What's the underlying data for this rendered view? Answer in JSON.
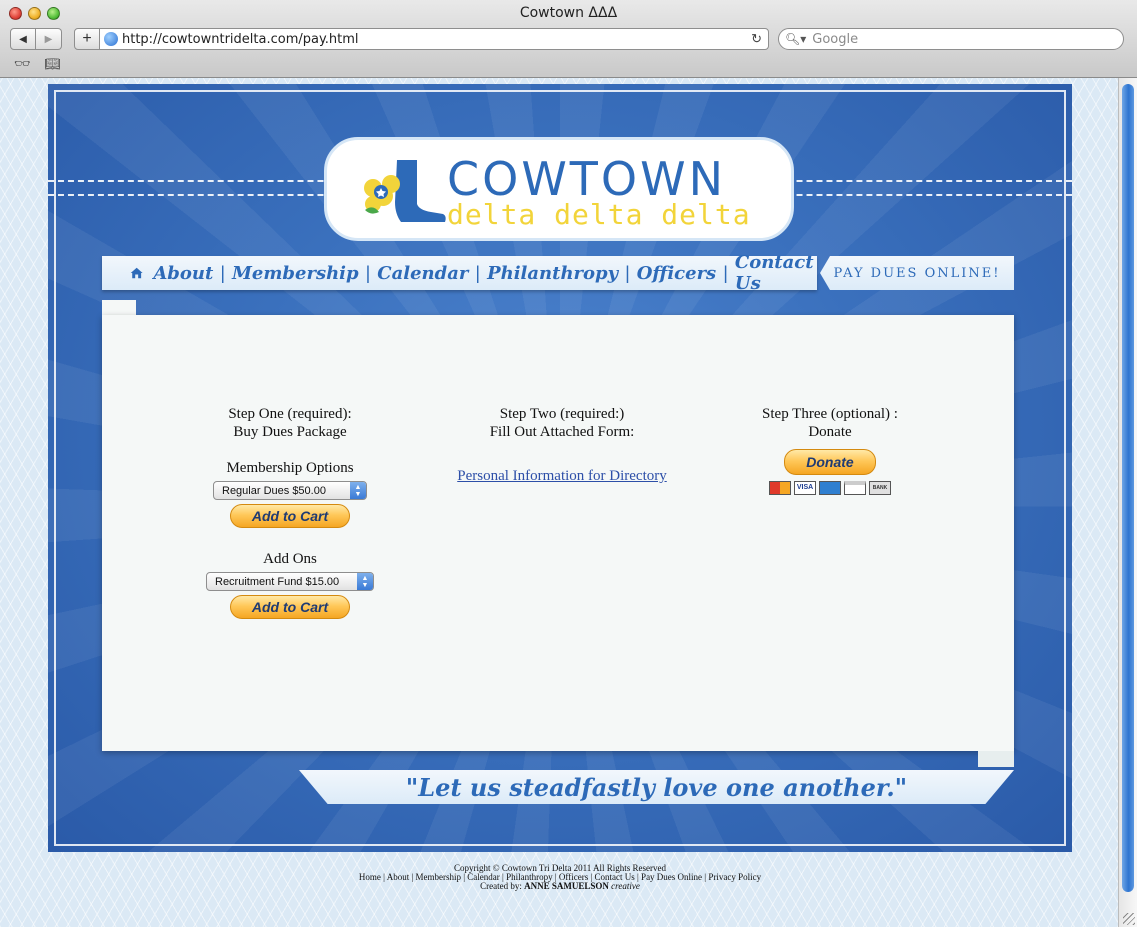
{
  "browser": {
    "window_title": "Cowtown ΔΔΔ",
    "url": "http://cowtowntridelta.com/pay.html",
    "search_placeholder": "Google"
  },
  "logo": {
    "name": "COWTOWN",
    "subtitle": "delta delta delta"
  },
  "nav": {
    "items": [
      "About",
      "Membership",
      "Calendar",
      "Philanthropy",
      "Officers",
      "Contact Us"
    ],
    "pay_dues": "PAY DUES ONLINE!"
  },
  "step1": {
    "title": "Step One (required):",
    "subtitle": "Buy Dues Package",
    "membership_heading": "Membership Options",
    "membership_select": "Regular Dues $50.00",
    "add_to_cart": "Add to Cart",
    "addons_heading": "Add Ons",
    "addons_select": "Recruitment Fund $15.00"
  },
  "step2": {
    "title": "Step Two (required:)",
    "subtitle": "Fill Out Attached Form:",
    "link": "Personal Information for Directory"
  },
  "step3": {
    "title": "Step Three (optional) :",
    "subtitle": "Donate",
    "donate_button": "Donate",
    "card_logos": [
      "mastercard",
      "VISA",
      "amex",
      "DISCOVER",
      "BANK"
    ]
  },
  "motto": "\"Let us steadfastly love one another.\"",
  "footer": {
    "copyright": "Copyright © Cowtown Tri Delta 2011 All Rights Reserved",
    "links": "Home | About | Membership | Calendar | Philanthropy | Officers | Contact Us | Pay Dues Online | Privacy Policy",
    "created_by_label": "Created by:",
    "created_by_name": "ANNE SAMUELSON",
    "created_by_suffix": "creative"
  },
  "colors": {
    "brand_blue": "#2d6ab8",
    "brand_yellow": "#f2d43a",
    "paypal_gold": "#ffc85a"
  }
}
